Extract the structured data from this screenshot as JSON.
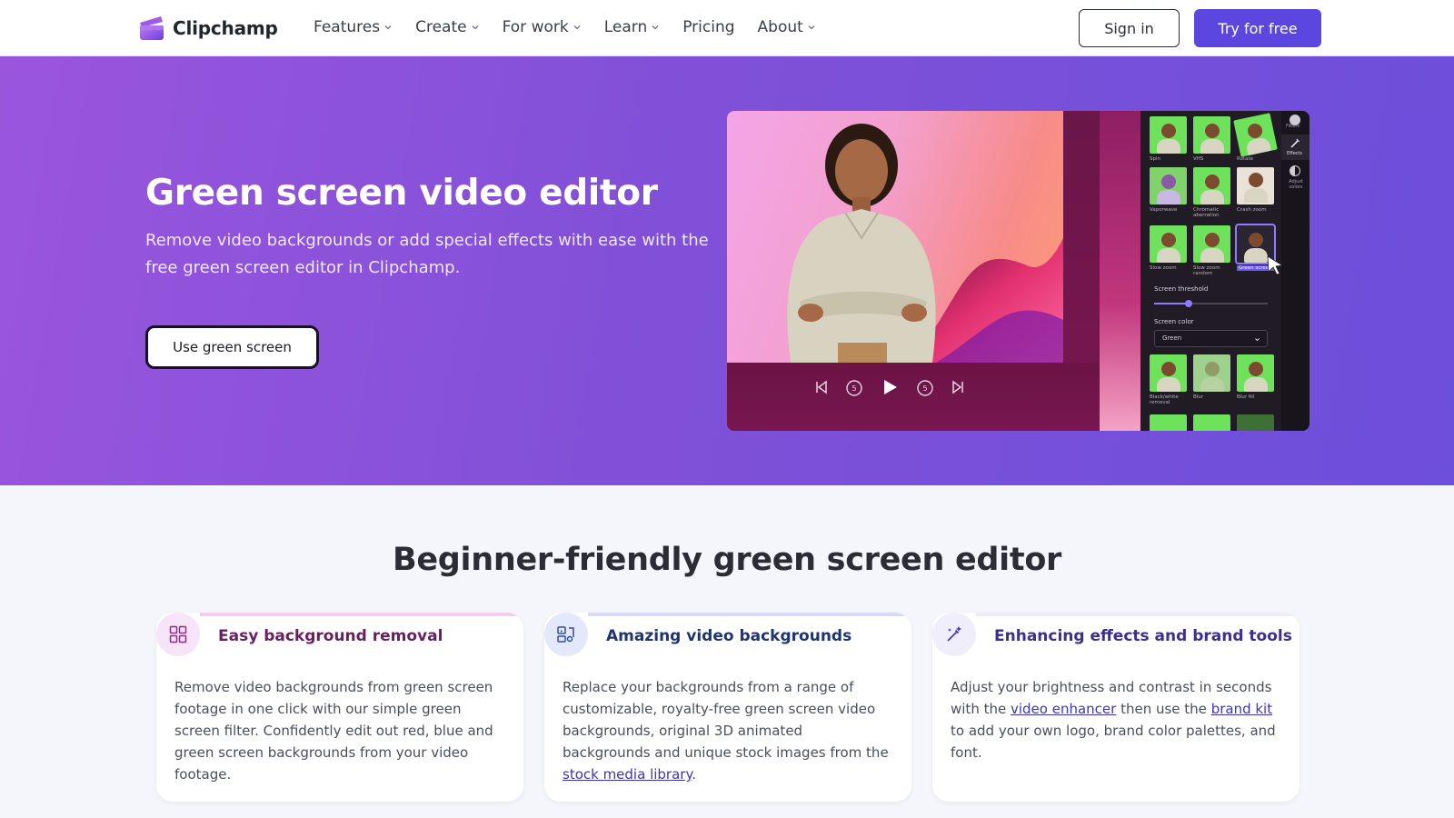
{
  "nav": {
    "brand": "Clipchamp",
    "menu": [
      {
        "label": "Features",
        "has_dropdown": true
      },
      {
        "label": "Create",
        "has_dropdown": true
      },
      {
        "label": "For work",
        "has_dropdown": true
      },
      {
        "label": "Learn",
        "has_dropdown": true
      },
      {
        "label": "Pricing",
        "has_dropdown": false
      },
      {
        "label": "About",
        "has_dropdown": true
      }
    ],
    "sign_in": "Sign in",
    "try_free": "Try for free"
  },
  "hero": {
    "title": "Green screen video editor",
    "subtitle": "Remove video backgrounds or add special effects with ease with the free green screen editor in Clipchamp.",
    "cta": "Use green screen",
    "preview": {
      "effects": [
        {
          "label": "Spin"
        },
        {
          "label": "VHS"
        },
        {
          "label": "Rotate"
        },
        {
          "label": "Vaporwave"
        },
        {
          "label": "Chromatic aberration"
        },
        {
          "label": "Crash zoom"
        },
        {
          "label": "Slow zoom"
        },
        {
          "label": "Slow zoom random"
        },
        {
          "label": "Green screen"
        },
        {
          "label": "Black/white removal"
        },
        {
          "label": "Blur"
        },
        {
          "label": "Blur fill"
        }
      ],
      "threshold_label": "Screen threshold",
      "threshold_value": 0.3,
      "color_label": "Screen color",
      "color_value": "Green",
      "rail": [
        {
          "label": "Filters"
        },
        {
          "label": "Effects"
        },
        {
          "label": "Adjust colors"
        }
      ]
    }
  },
  "features": {
    "title": "Beginner-friendly green screen editor",
    "cards": [
      {
        "title": "Easy background removal",
        "icon": "grid-icon",
        "text_parts": [
          "Remove video backgrounds from green screen footage in one click with our simple green screen filter. Confidently edit out red, blue and green screen backgrounds from your video footage."
        ],
        "colors": {
          "accent": "#f5cdf0",
          "icon_bg": "#f8e4f8",
          "title": "#6a1f63"
        }
      },
      {
        "title": "Amazing video backgrounds",
        "icon": "media-icon",
        "text_before": "Replace your backgrounds from a range of customizable, royalty-free green screen video backgrounds, original 3D animated backgrounds and unique stock images from the ",
        "link": "stock media library",
        "text_after": ".",
        "colors": {
          "accent": "#d6dcf7",
          "icon_bg": "#e4e8fb",
          "title": "#1f3470"
        }
      },
      {
        "title": "Enhancing effects and brand tools",
        "icon": "magic-wand-icon",
        "text_before": "Adjust your brightness and contrast in seconds with the ",
        "link1": "video enhancer",
        "text_middle": " then use the ",
        "link2": "brand kit",
        "text_after": " to add your own logo, brand color palettes, and font.",
        "colors": {
          "accent": "#eeebfa",
          "icon_bg": "#f0eefb",
          "title": "#3c2f8f"
        }
      }
    ]
  }
}
